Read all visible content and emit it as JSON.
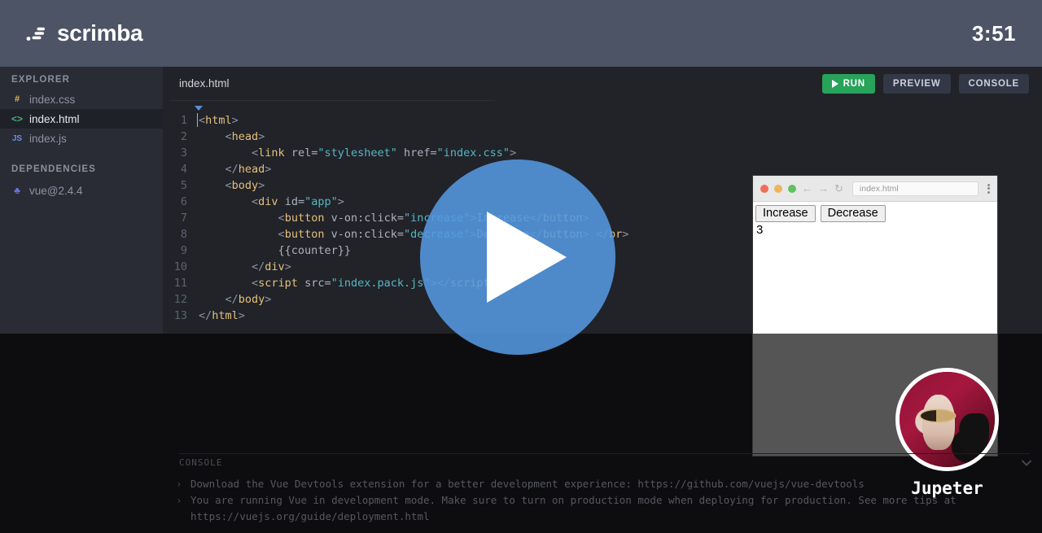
{
  "header": {
    "brand": "scrimba",
    "logo_icon": "scrimba-logo-icon",
    "timer": "3:51"
  },
  "sidebar": {
    "explorer_label": "EXPLORER",
    "files": [
      {
        "name": "index.css",
        "icon": "css-file-icon",
        "glyph": "#",
        "active": false
      },
      {
        "name": "index.html",
        "icon": "html-file-icon",
        "glyph": "<>",
        "active": true
      },
      {
        "name": "index.js",
        "icon": "js-file-icon",
        "glyph": "JS",
        "active": false
      }
    ],
    "dependencies_label": "DEPENDENCIES",
    "dependencies": [
      {
        "name": "vue@2.4.4",
        "icon": "package-icon",
        "glyph": "♣"
      }
    ]
  },
  "editor": {
    "tab_name": "index.html",
    "run_label": "RUN",
    "run_icon": "play-icon",
    "preview_label": "PREVIEW",
    "console_label": "CONSOLE",
    "accent_green": "#27a35a",
    "lines": [
      {
        "n": "1",
        "tokens": [
          {
            "t": "br",
            "v": "<"
          },
          {
            "t": "tg",
            "v": "html"
          },
          {
            "t": "br",
            "v": ">"
          }
        ],
        "cursor": true
      },
      {
        "n": "2",
        "tokens": [
          {
            "t": "at",
            "v": "    "
          },
          {
            "t": "br",
            "v": "<"
          },
          {
            "t": "tg",
            "v": "head"
          },
          {
            "t": "br",
            "v": ">"
          }
        ]
      },
      {
        "n": "3",
        "tokens": [
          {
            "t": "at",
            "v": "        "
          },
          {
            "t": "br",
            "v": "<"
          },
          {
            "t": "tg",
            "v": "link"
          },
          {
            "t": "at",
            "v": " rel="
          },
          {
            "t": "st",
            "v": "\"stylesheet\""
          },
          {
            "t": "at",
            "v": " href="
          },
          {
            "t": "st",
            "v": "\"index.css\""
          },
          {
            "t": "br",
            "v": ">"
          }
        ]
      },
      {
        "n": "4",
        "tokens": [
          {
            "t": "at",
            "v": "    "
          },
          {
            "t": "br",
            "v": "</"
          },
          {
            "t": "tg",
            "v": "head"
          },
          {
            "t": "br",
            "v": ">"
          }
        ]
      },
      {
        "n": "5",
        "tokens": [
          {
            "t": "at",
            "v": "    "
          },
          {
            "t": "br",
            "v": "<"
          },
          {
            "t": "tg",
            "v": "body"
          },
          {
            "t": "br",
            "v": ">"
          }
        ]
      },
      {
        "n": "6",
        "tokens": [
          {
            "t": "at",
            "v": "        "
          },
          {
            "t": "br",
            "v": "<"
          },
          {
            "t": "tg",
            "v": "div"
          },
          {
            "t": "at",
            "v": " id="
          },
          {
            "t": "st",
            "v": "\"app\""
          },
          {
            "t": "br",
            "v": ">"
          }
        ]
      },
      {
        "n": "7",
        "tokens": [
          {
            "t": "at",
            "v": "            "
          },
          {
            "t": "br",
            "v": "<"
          },
          {
            "t": "tg",
            "v": "button"
          },
          {
            "t": "at",
            "v": " v-on:click="
          },
          {
            "t": "st",
            "v": "\"increase\""
          },
          {
            "t": "br",
            "v": ">"
          },
          {
            "t": "at",
            "v": "Increase"
          },
          {
            "t": "br",
            "v": "</"
          },
          {
            "t": "tg",
            "v": "button"
          },
          {
            "t": "br",
            "v": ">"
          }
        ]
      },
      {
        "n": "8",
        "tokens": [
          {
            "t": "at",
            "v": "            "
          },
          {
            "t": "br",
            "v": "<"
          },
          {
            "t": "tg",
            "v": "button"
          },
          {
            "t": "at",
            "v": " v-on:click="
          },
          {
            "t": "st",
            "v": "\"decrease\""
          },
          {
            "t": "br",
            "v": ">"
          },
          {
            "t": "at",
            "v": "Decrease"
          },
          {
            "t": "br",
            "v": "</"
          },
          {
            "t": "tg",
            "v": "button"
          },
          {
            "t": "br",
            "v": "> </"
          },
          {
            "t": "tg",
            "v": "br"
          },
          {
            "t": "br",
            "v": ">"
          }
        ]
      },
      {
        "n": "9",
        "tokens": [
          {
            "t": "at",
            "v": "            "
          },
          {
            "t": "at",
            "v": "{{counter}}"
          }
        ]
      },
      {
        "n": "10",
        "tokens": [
          {
            "t": "at",
            "v": "        "
          },
          {
            "t": "br",
            "v": "</"
          },
          {
            "t": "tg",
            "v": "div"
          },
          {
            "t": "br",
            "v": ">"
          }
        ]
      },
      {
        "n": "11",
        "tokens": [
          {
            "t": "at",
            "v": "        "
          },
          {
            "t": "br",
            "v": "<"
          },
          {
            "t": "tg",
            "v": "script"
          },
          {
            "t": "at",
            "v": " src="
          },
          {
            "t": "st",
            "v": "\"index.pack.js\""
          },
          {
            "t": "br",
            "v": "></"
          },
          {
            "t": "tg",
            "v": "script"
          },
          {
            "t": "br",
            "v": ">"
          }
        ]
      },
      {
        "n": "12",
        "tokens": [
          {
            "t": "at",
            "v": "    "
          },
          {
            "t": "br",
            "v": "</"
          },
          {
            "t": "tg",
            "v": "body"
          },
          {
            "t": "br",
            "v": ">"
          }
        ]
      },
      {
        "n": "13",
        "tokens": [
          {
            "t": "br",
            "v": "</"
          },
          {
            "t": "tg",
            "v": "html"
          },
          {
            "t": "br",
            "v": ">"
          }
        ]
      }
    ]
  },
  "play_overlay": {
    "icon": "play-icon",
    "color": "#5499e0"
  },
  "preview": {
    "url": "index.html",
    "traffic_lights": [
      "close-dot",
      "minimize-dot",
      "maximize-dot"
    ],
    "back_icon": "arrow-left-icon",
    "forward_icon": "arrow-right-icon",
    "reload_icon": "reload-icon",
    "menu_icon": "kebab-menu-icon",
    "buttons": [
      "Increase",
      "Decrease"
    ],
    "counter": "3"
  },
  "presenter": {
    "name": "Jupeter",
    "avatar": "presenter-avatar"
  },
  "console": {
    "title": "CONSOLE",
    "collapse_icon": "chevron-down-icon",
    "messages": [
      "Download the Vue Devtools extension for a better development experience: https://github.com/vuejs/vue-devtools",
      "You are running Vue in development mode. Make sure to turn on production mode when deploying for production. See more tips at\nhttps://vuejs.org/guide/deployment.html"
    ]
  }
}
